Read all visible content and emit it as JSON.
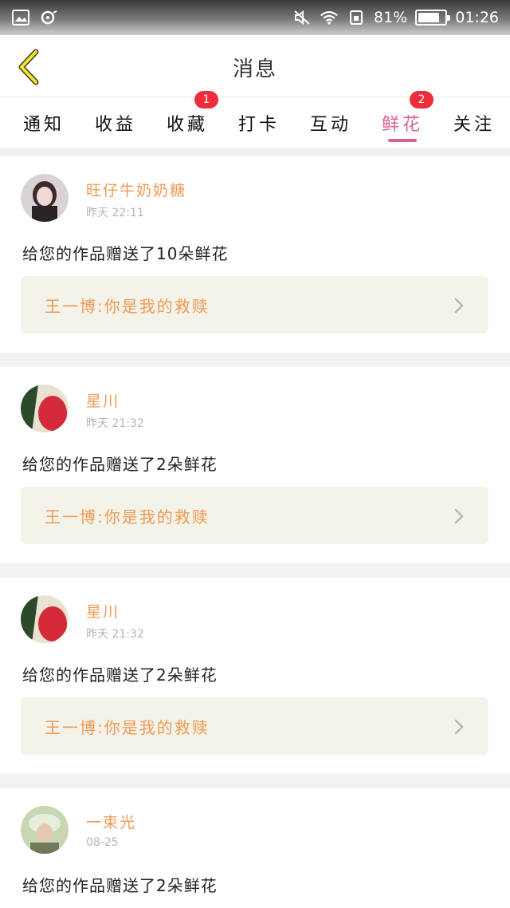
{
  "status_bar": {
    "battery": "81%",
    "time": "01:26",
    "battery_level": 0.81
  },
  "header": {
    "title": "消息"
  },
  "tabs": [
    {
      "label": "通知",
      "badge": ""
    },
    {
      "label": "收益",
      "badge": ""
    },
    {
      "label": "收藏",
      "badge": "1"
    },
    {
      "label": "打卡",
      "badge": ""
    },
    {
      "label": "互动",
      "badge": ""
    },
    {
      "label": "鲜花",
      "badge": "2"
    },
    {
      "label": "关注",
      "badge": ""
    }
  ],
  "active_tab": "鲜花",
  "colors": {
    "accent": "#d9609a",
    "name": "#f09a52",
    "badge": "#ee2d3c",
    "work_bg": "#f4f3ea"
  },
  "messages": [
    {
      "user": "旺仔牛奶奶糖",
      "time": "昨天 22:11",
      "text": "给您的作品赠送了10朵鲜花",
      "work": "王一博:你是我的救赎"
    },
    {
      "user": "星川",
      "time": "昨天 21:32",
      "text": "给您的作品赠送了2朵鲜花",
      "work": "王一博:你是我的救赎"
    },
    {
      "user": "星川",
      "time": "昨天 21:32",
      "text": "给您的作品赠送了2朵鲜花",
      "work": "王一博:你是我的救赎"
    },
    {
      "user": "一束光",
      "time": "08-25",
      "text": "给您的作品赠送了2朵鲜花",
      "work": ""
    }
  ]
}
